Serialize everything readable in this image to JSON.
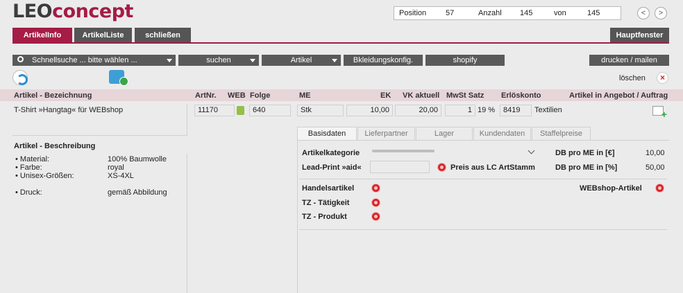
{
  "logo": {
    "part1": "LEO",
    "part2": "concept"
  },
  "record_nav": {
    "position_label": "Position",
    "position_value": "57",
    "count_label": "Anzahl",
    "count_value": "145",
    "of_label": "von",
    "of_value": "145",
    "prev": "<",
    "next": ">"
  },
  "top_tabs": {
    "artikelinfo": "ArtikelInfo",
    "artikelliste": "ArtikelListe",
    "schliessen": "schließen",
    "hauptfenster": "Hauptfenster"
  },
  "toolbar": {
    "schnellsuche": "Schnellsuche ... bitte wählen ...",
    "suchen": "suchen",
    "artikel": "Artikel",
    "bkleidung": "Bkleidungskonfig.",
    "shopify": "shopify",
    "drucken": "drucken / mailen"
  },
  "actions": {
    "loeschen": "löschen"
  },
  "header": {
    "bezeichnung": "Artikel - Bezeichnung",
    "artnr": "ArtNr.",
    "web": "WEB",
    "folge": "Folge",
    "me": "ME",
    "ek": "EK",
    "vk": "VK aktuell",
    "mwst": "MwSt Satz",
    "erloeskonto": "Erlöskonto",
    "angebot": "Artikel in Angebot / Auftrag"
  },
  "article": {
    "bezeichnung": "T-Shirt »Hangtag« für WEBshop",
    "artnr": "11170",
    "folge": "640",
    "me": "Stk",
    "ek": "10,00",
    "vk": "20,00",
    "mwst_num": "1",
    "mwst_pct": "19 %",
    "konto": "8419",
    "konto_name": "Textilien"
  },
  "beschreibung": {
    "label": "Artikel - Beschreibung",
    "rows": [
      {
        "k": "• Material:",
        "v": "100% Baumwolle"
      },
      {
        "k": "• Farbe:",
        "v": "royal"
      },
      {
        "k": "• Unisex-Größen:",
        "v": "XS-4XL"
      },
      {
        "k": "• Druck:",
        "v": "gemäß Abbildung"
      }
    ]
  },
  "sub_tabs": [
    "Basisdaten",
    "Lieferpartner",
    "Lager",
    "Kundendaten",
    "Staffelpreise"
  ],
  "basis": {
    "kategorie_label": "Artikelkategorie",
    "leadprint_label": "Lead-Print »aid«",
    "preis_lc_label": "Preis aus LC ArtStamm",
    "db_eur_label": "DB pro ME in [€]",
    "db_eur_value": "10,00",
    "db_pct_label": "DB pro ME in [%]",
    "db_pct_value": "50,00",
    "handelsartikel": "Handelsartikel",
    "webshop": "WEBshop-Artikel",
    "tz_taetigkeit": "TZ - Tätigkeit",
    "tz_produkt": "TZ - Produkt"
  }
}
